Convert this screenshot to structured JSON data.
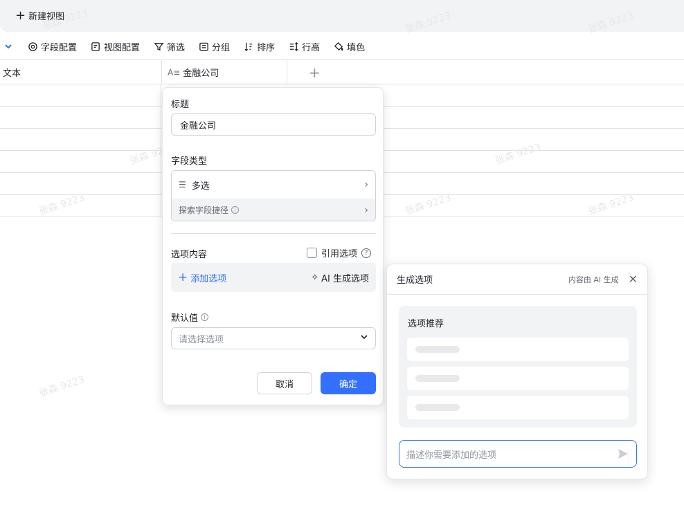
{
  "topbar": {
    "new_view_label": "新建视图"
  },
  "toolbar": {
    "items": [
      {
        "label": "字段配置",
        "icon": "gear-icon"
      },
      {
        "label": "视图配置",
        "icon": "view-config-icon"
      },
      {
        "label": "筛选",
        "icon": "filter-icon"
      },
      {
        "label": "分组",
        "icon": "group-icon"
      },
      {
        "label": "排序",
        "icon": "sort-icon"
      },
      {
        "label": "行高",
        "icon": "row-height-icon"
      },
      {
        "label": "填色",
        "icon": "fill-color-icon"
      }
    ]
  },
  "grid": {
    "columns": [
      {
        "label": "文本"
      },
      {
        "label": "金融公司",
        "icon": "text-type-icon"
      }
    ],
    "add_column_symbol": "+"
  },
  "watermark_text": "张森 9223",
  "field_panel": {
    "title_label": "标题",
    "title_value": "金融公司",
    "field_type_label": "字段类型",
    "field_type_value": "多选",
    "shortcut_label": "探索字段捷径",
    "options_label": "选项内容",
    "ref_options_label": "引用选项",
    "add_option_label": "添加选项",
    "ai_generate_label": "AI 生成选项",
    "default_label": "默认值",
    "default_placeholder": "请选择选项",
    "cancel_label": "取消",
    "ok_label": "确定"
  },
  "generate_panel": {
    "title": "生成选项",
    "note": "内容由 AI 生成",
    "card_title": "选项推荐",
    "input_placeholder": "描述你需要添加的选项"
  },
  "colors": {
    "accent": "#3370ff",
    "border": "#dee0e3",
    "panel_bg": "#f2f3f5"
  }
}
